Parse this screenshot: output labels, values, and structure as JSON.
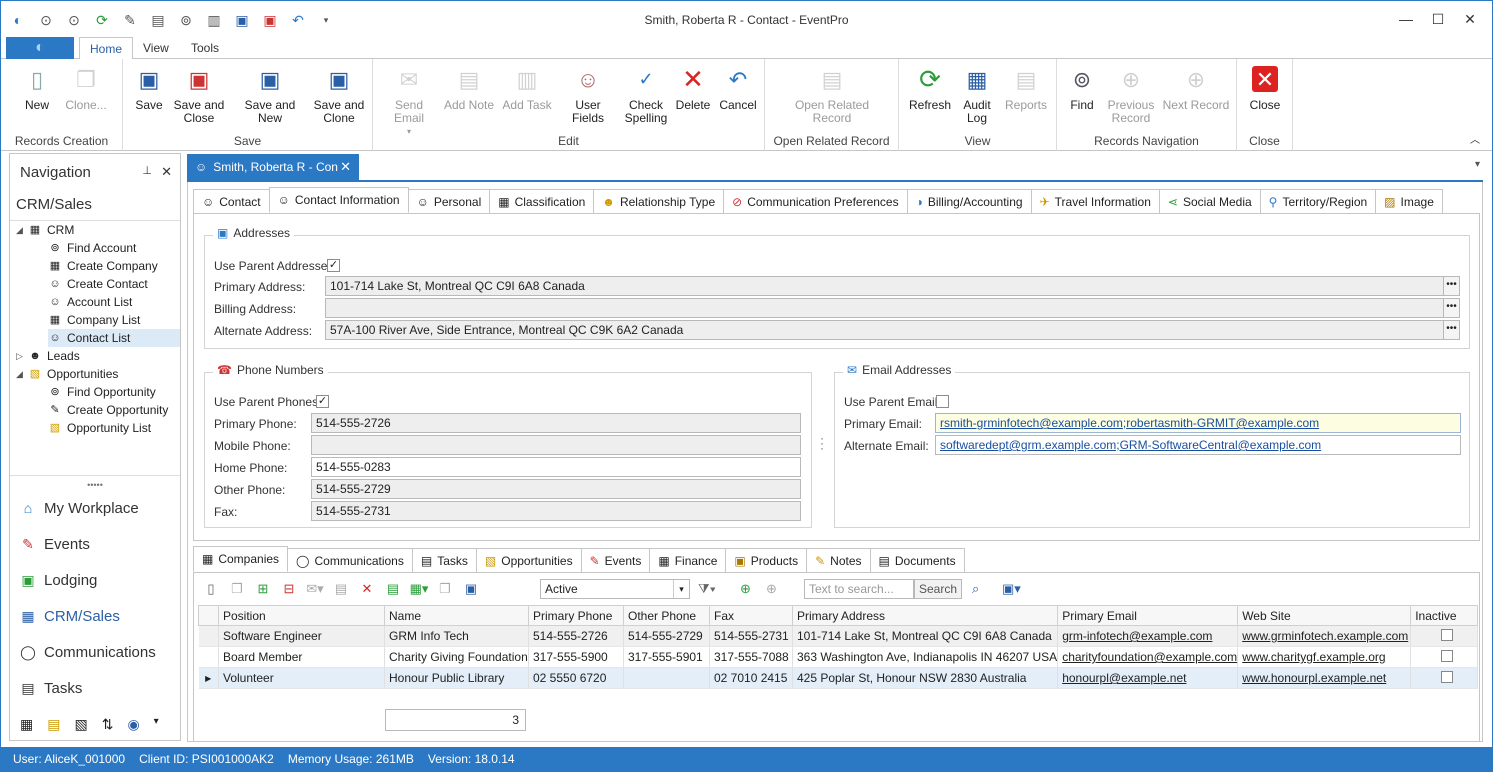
{
  "window": {
    "title": "Smith, Roberta R - Contact - EventPro",
    "quick_access_icons": [
      "eventpro-logo-icon",
      "back-icon",
      "forward-icon",
      "refresh-icon",
      "user-fields-icon",
      "clipboard-icon",
      "find-icon",
      "notes-icon",
      "save-icon",
      "save-close-icon",
      "undo-icon",
      "customize-icon"
    ]
  },
  "ribbon_tabs": [
    "Home",
    "View",
    "Tools"
  ],
  "ribbon": {
    "groups": [
      {
        "label": "Records Creation",
        "buttons": [
          {
            "label": "New"
          },
          {
            "label": "Clone..."
          }
        ]
      },
      {
        "label": "Save",
        "buttons": [
          {
            "label": "Save"
          },
          {
            "label": "Save and Close"
          },
          {
            "label": "Save and New"
          },
          {
            "label": "Save and Clone"
          }
        ]
      },
      {
        "label": "Edit",
        "buttons": [
          {
            "label": "Send Email"
          },
          {
            "label": "Add Note"
          },
          {
            "label": "Add Task"
          },
          {
            "label": "User Fields"
          },
          {
            "label": "Check Spelling"
          },
          {
            "label": "Delete"
          },
          {
            "label": "Cancel"
          }
        ]
      },
      {
        "label": "Open Related Record",
        "buttons": [
          {
            "label": "Open Related Record"
          }
        ]
      },
      {
        "label": "View",
        "buttons": [
          {
            "label": "Refresh"
          },
          {
            "label": "Audit Log"
          },
          {
            "label": "Reports"
          }
        ]
      },
      {
        "label": "Records Navigation",
        "buttons": [
          {
            "label": "Find"
          },
          {
            "label": "Previous Record"
          },
          {
            "label": "Next Record"
          }
        ]
      },
      {
        "label": "Close",
        "buttons": [
          {
            "label": "Close"
          }
        ]
      }
    ]
  },
  "navigation": {
    "header": "Navigation",
    "section": "CRM/Sales",
    "tree": {
      "crm": "CRM",
      "crm_items": [
        "Find Account",
        "Create Company",
        "Create Contact",
        "Account List",
        "Company List",
        "Contact List"
      ],
      "leads": "Leads",
      "opportunities": "Opportunities",
      "opp_items": [
        "Find Opportunity",
        "Create Opportunity",
        "Opportunity List"
      ]
    },
    "big_items": [
      "My Workplace",
      "Events",
      "Lodging",
      "CRM/Sales",
      "Communications",
      "Tasks"
    ],
    "active": "CRM/Sales"
  },
  "document_tab": "Smith, Roberta R - Con",
  "record_tabs": [
    "Contact",
    "Contact Information",
    "Personal",
    "Classification",
    "Relationship Type",
    "Communication Preferences",
    "Billing/Accounting",
    "Travel Information",
    "Social Media",
    "Territory/Region",
    "Image"
  ],
  "addresses": {
    "title": "Addresses",
    "use_parent_label": "Use Parent Addresses",
    "use_parent_checked": true,
    "primary_label": "Primary Address:",
    "primary_value": "101-714 Lake St, Montreal QC C9I 6A8 Canada",
    "billing_label": "Billing Address:",
    "billing_value": "",
    "alternate_label": "Alternate Address:",
    "alternate_value": "57A-100 River Ave, Side Entrance, Montreal QC C9K 6A2 Canada"
  },
  "phones": {
    "title": "Phone Numbers",
    "use_parent_label": "Use Parent Phones",
    "use_parent_checked": true,
    "primary_label": "Primary Phone:",
    "primary_value": "514-555-2726",
    "mobile_label": "Mobile Phone:",
    "mobile_value": "",
    "home_label": "Home Phone:",
    "home_value": "514-555-0283",
    "other_label": "Other Phone:",
    "other_value": "514-555-2729",
    "fax_label": "Fax:",
    "fax_value": "514-555-2731"
  },
  "emails": {
    "title": "Email Addresses",
    "use_parent_label": "Use Parent Emails",
    "use_parent_checked": false,
    "primary_label": "Primary Email:",
    "primary_value": "rsmith-grminfotech@example.com;robertasmith-GRMIT@example.com",
    "alternate_label": "Alternate Email:",
    "alternate_value": "softwaredept@grm.example.com;GRM-SoftwareCentral@example.com"
  },
  "related_tabs": [
    "Companies",
    "Communications",
    "Tasks",
    "Opportunities",
    "Events",
    "Finance",
    "Products",
    "Notes",
    "Documents"
  ],
  "grid": {
    "filter_value": "Active",
    "search_placeholder": "Text to search...",
    "search_button": "Search",
    "columns": [
      "Position",
      "Name",
      "Primary Phone",
      "Other Phone",
      "Fax",
      "Primary Address",
      "Primary Email",
      "Web Site",
      "Inactive"
    ],
    "rows": [
      [
        "Software Engineer",
        "GRM Info Tech",
        "514-555-2726",
        "514-555-2729",
        "514-555-2731",
        "101-714 Lake St, Montreal QC C9I 6A8 Canada",
        "grm-infotech@example.com",
        "www.grminfotech.example.com"
      ],
      [
        "Board Member",
        "Charity Giving Foundation",
        "317-555-5900",
        "317-555-5901",
        "317-555-7088",
        "363 Washington Ave, Indianapolis IN 46207 USA",
        "charityfoundation@example.com",
        "www.charitygf.example.org"
      ],
      [
        "Volunteer",
        "Honour Public Library",
        "02 5550 6720",
        "",
        "02 7010 2415",
        "425 Poplar St, Honour NSW 2830 Australia",
        "honourpl@example.net",
        "www.honourpl.example.net"
      ]
    ],
    "count": "3"
  },
  "status": {
    "user": "User: AliceK_001000",
    "client": "Client ID: PSI001000AK2",
    "memory": "Memory Usage: 261MB",
    "version": "Version: 18.0.14"
  },
  "colors": {
    "accent": "#2b78c5",
    "link": "#1a4fa0",
    "selection": "#dce9f7"
  }
}
